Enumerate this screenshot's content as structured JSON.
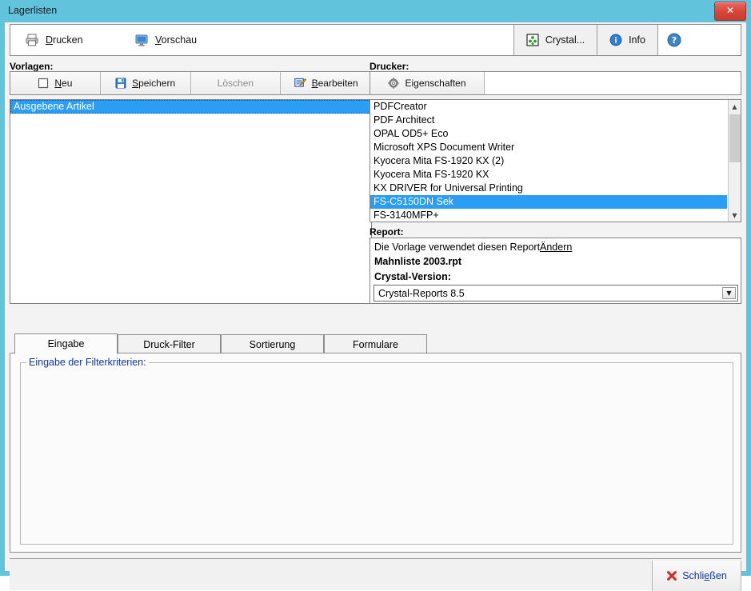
{
  "window": {
    "title": "Lagerlisten",
    "close_glyph": "✕",
    "titlebar_color": "#62c3dd",
    "close_button_color": "#d9473c"
  },
  "toolbar": {
    "print": {
      "label": "Drucken",
      "accel": "D",
      "icon": "printer-icon"
    },
    "preview": {
      "label": "Vorschau",
      "accel": "V",
      "icon": "monitor-icon"
    },
    "crystal": {
      "label": "Crystal...",
      "icon": "crystal-icon"
    },
    "info": {
      "label": "Info",
      "icon": "info-icon"
    },
    "help": {
      "label": "?",
      "icon": "help-icon"
    }
  },
  "templates": {
    "section_label": "Vorlagen:",
    "buttons": [
      {
        "label": "Neu",
        "accel": "N",
        "icon": "new-document-icon",
        "disabled": false
      },
      {
        "label": "Speichern",
        "accel": "S",
        "icon": "save-disk-icon",
        "disabled": false
      },
      {
        "label": "Löschen",
        "accel": "",
        "icon": "",
        "disabled": true
      },
      {
        "label": "Bearbeiten",
        "accel": "B",
        "icon": "edit-pencil-icon",
        "disabled": false
      }
    ],
    "items": [
      {
        "label": "Ausgebene Artikel",
        "selected": true
      }
    ]
  },
  "printer": {
    "section_label": "Drucker:",
    "properties_button": {
      "label": "Eigenschaften",
      "icon": "gear-icon"
    },
    "items": [
      {
        "label": "PDFCreator",
        "selected": false
      },
      {
        "label": "PDF Architect",
        "selected": false
      },
      {
        "label": "OPAL OD5+ Eco",
        "selected": false
      },
      {
        "label": "Microsoft XPS Document Writer",
        "selected": false
      },
      {
        "label": "Kyocera Mita FS-1920 KX (2)",
        "selected": false
      },
      {
        "label": "Kyocera Mita FS-1920 KX",
        "selected": false
      },
      {
        "label": "KX DRIVER for Universal Printing",
        "selected": false
      },
      {
        "label": "FS-C5150DN Sek",
        "selected": true
      },
      {
        "label": "FS-3140MFP+",
        "selected": false
      }
    ],
    "scrollbar": {
      "up_glyph": "▲",
      "down_glyph": "▼"
    }
  },
  "report": {
    "section_label": "Report:",
    "description": "Die Vorlage verwendet diesen Report",
    "change_link": "Ändern",
    "file_name": "Mahnliste 2003.rpt",
    "version_label": "Crystal-Version:",
    "version_value": "Crystal-Reports 8.5",
    "version_options": [
      "Crystal-Reports 8.5"
    ],
    "dropdown_glyph": "▼"
  },
  "tabs": [
    {
      "label": "Eingabe",
      "active": true
    },
    {
      "label": "Druck-Filter",
      "active": false
    },
    {
      "label": "Sortierung",
      "active": false
    },
    {
      "label": "Formulare",
      "active": false
    }
  ],
  "tabpage": {
    "groupbox_label": "Eingabe der Filterkriterien:",
    "groupbox_label_color": "#1136a5",
    "content": ""
  },
  "footer": {
    "close": {
      "label": "Schließen",
      "accel": "e",
      "icon": "red-x-icon",
      "color": "#1136a5"
    }
  }
}
